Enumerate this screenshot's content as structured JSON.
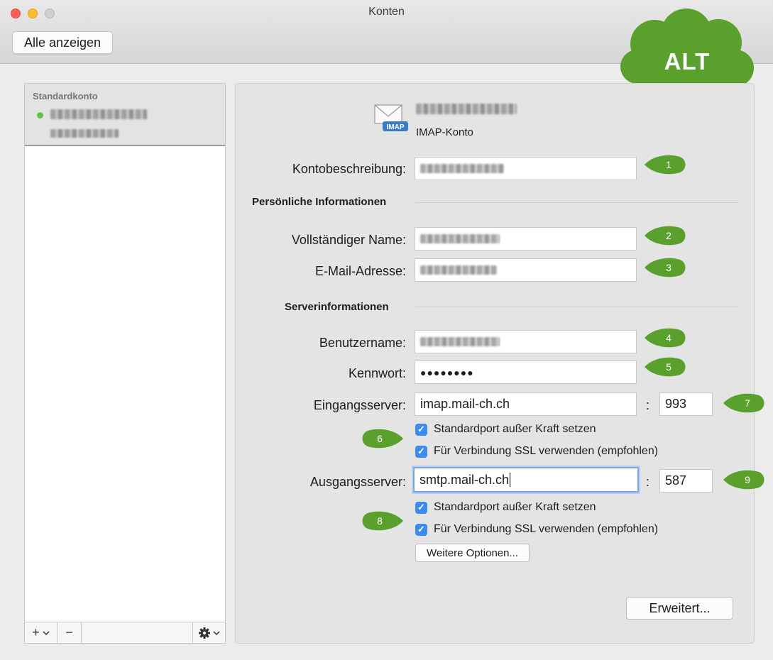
{
  "window": {
    "title": "Konten",
    "show_all_label": "Alle anzeigen"
  },
  "cloud": {
    "label": "ALT",
    "color": "#5aa02c"
  },
  "sidebar": {
    "group_label": "Standardkonto",
    "status_color": "#64c04b",
    "add_label": "+",
    "remove_label": "−"
  },
  "account": {
    "type_label": "IMAP-Konto",
    "icon_text": "IMAP"
  },
  "form": {
    "description_label": "Kontobeschreibung:",
    "personal_section": "Persönliche Informationen",
    "fullname_label": "Vollständiger Name:",
    "email_label": "E-Mail-Adresse:",
    "server_section": "Serverinformationen",
    "username_label": "Benutzername:",
    "password_label": "Kennwort:",
    "password_value": "●●●●●●●●",
    "incoming_label": "Eingangsserver:",
    "incoming_value": "imap.mail-ch.ch",
    "incoming_port": "993",
    "outgoing_label": "Ausgangsserver:",
    "outgoing_value": "smtp.mail-ch.ch",
    "outgoing_port": "587",
    "colon": ":",
    "override_port_label": "Standardport außer Kraft setzen",
    "ssl_label": "Für Verbindung SSL verwenden (empfohlen)",
    "more_options_label": "Weitere Optionen...",
    "advanced_label": "Erweitert..."
  },
  "badges": [
    "1",
    "2",
    "3",
    "4",
    "5",
    "6",
    "7",
    "8",
    "9"
  ],
  "badge_color": "#5aa02c"
}
